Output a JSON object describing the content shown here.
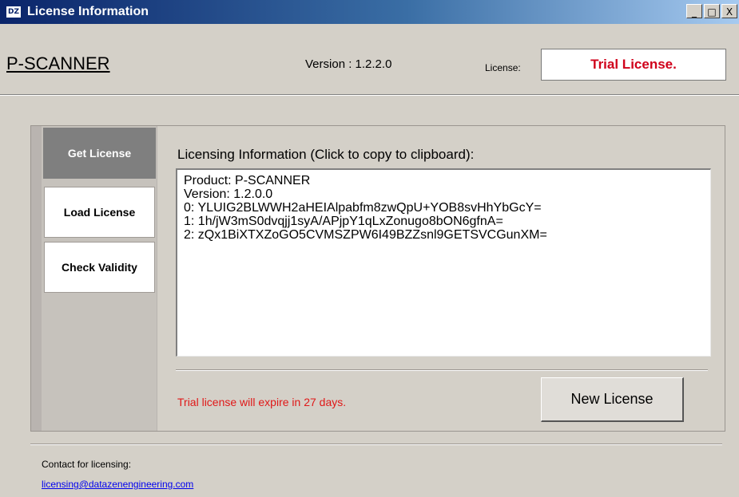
{
  "window": {
    "title": "License Information",
    "icon_text": "DZ",
    "controls": {
      "minimize": "_",
      "maximize": "□",
      "close": "X"
    }
  },
  "header": {
    "app_name": "P-SCANNER",
    "version": "Version : 1.2.2.0",
    "license_label": "License:",
    "license_value": "Trial License."
  },
  "tabs": [
    {
      "label": "Get License",
      "active": true
    },
    {
      "label": "Load License",
      "active": false
    },
    {
      "label": "Check Validity",
      "active": false
    }
  ],
  "main": {
    "heading": "Licensing Information (Click to copy to clipboard):",
    "lines": [
      "Product: P-SCANNER",
      "Version: 1.2.0.0",
      "0: YLUIG2BLWWH2aHEIAlpabfm8zwQpU+YOB8svHhYbGcY=",
      "1: 1h/jW3mS0dvqjj1syA/APjpY1qLxZonugo8bON6gfnA=",
      "2: zQx1BiXTXZoGO5CVMSZPW6I49BZZsnl9GETSVCGunXM="
    ],
    "expiry": "Trial license will expire in 27 days.",
    "new_license_button": "New License"
  },
  "footer": {
    "contact_label": "Contact for licensing:",
    "email": "licensing@datazenengineering.com"
  },
  "colors": {
    "title_bar": "#0a246a",
    "license_text": "#d0021b",
    "active_tab": "#7f7f7f",
    "expiry_text": "#e01818",
    "link": "#0000ee"
  }
}
